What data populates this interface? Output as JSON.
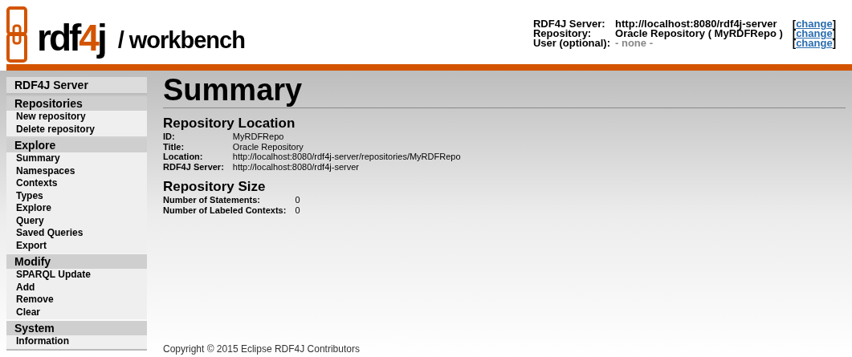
{
  "logo": {
    "parts": [
      {
        "text": "rdf",
        "accent": false
      },
      {
        "text": "4",
        "accent": true
      },
      {
        "text": "j",
        "accent": false
      }
    ],
    "subtitle": "/ workbench"
  },
  "header_info": [
    {
      "label": "RDF4J Server:",
      "value": "http://localhost:8080/rdf4j-server",
      "muted": false,
      "open": "[",
      "link": "change",
      "close": "]"
    },
    {
      "label": "Repository:",
      "value": "Oracle Repository ( MyRDFRepo )",
      "muted": false,
      "open": "[",
      "link": "change",
      "close": "]"
    },
    {
      "label": "User (optional):",
      "value": "- none -",
      "muted": true,
      "open": "[",
      "link": "change",
      "close": "]"
    }
  ],
  "sidebar": [
    {
      "title": "RDF4J Server"
    },
    {
      "title": "Repositories",
      "items": [
        "New repository",
        "Delete repository"
      ]
    },
    {
      "title": "Explore",
      "items": [
        "Summary",
        "Namespaces",
        "Contexts",
        "Types",
        "Explore",
        "Query",
        "Saved Queries",
        "Export"
      ]
    },
    {
      "title": "Modify",
      "items": [
        "SPARQL Update",
        "Add",
        "Remove",
        "Clear"
      ]
    },
    {
      "title": "System",
      "items": [
        "Information"
      ]
    }
  ],
  "page_title": "Summary",
  "sections": [
    {
      "title": "Repository Location",
      "rows": [
        {
          "label": "ID:",
          "value": "MyRDFRepo"
        },
        {
          "label": "Title:",
          "value": "Oracle Repository"
        },
        {
          "label": "Location:",
          "value": "http://localhost:8080/rdf4j-server/repositories/MyRDFRepo"
        },
        {
          "label": "RDF4J Server:",
          "value": "http://localhost:8080/rdf4j-server"
        }
      ]
    },
    {
      "title": "Repository Size",
      "rows": [
        {
          "label": "Number of Statements:",
          "value": "0"
        },
        {
          "label": "Number of Labeled Contexts:",
          "value": "0"
        }
      ]
    }
  ],
  "footer": "Copyright © 2015 Eclipse RDF4J Contributors"
}
